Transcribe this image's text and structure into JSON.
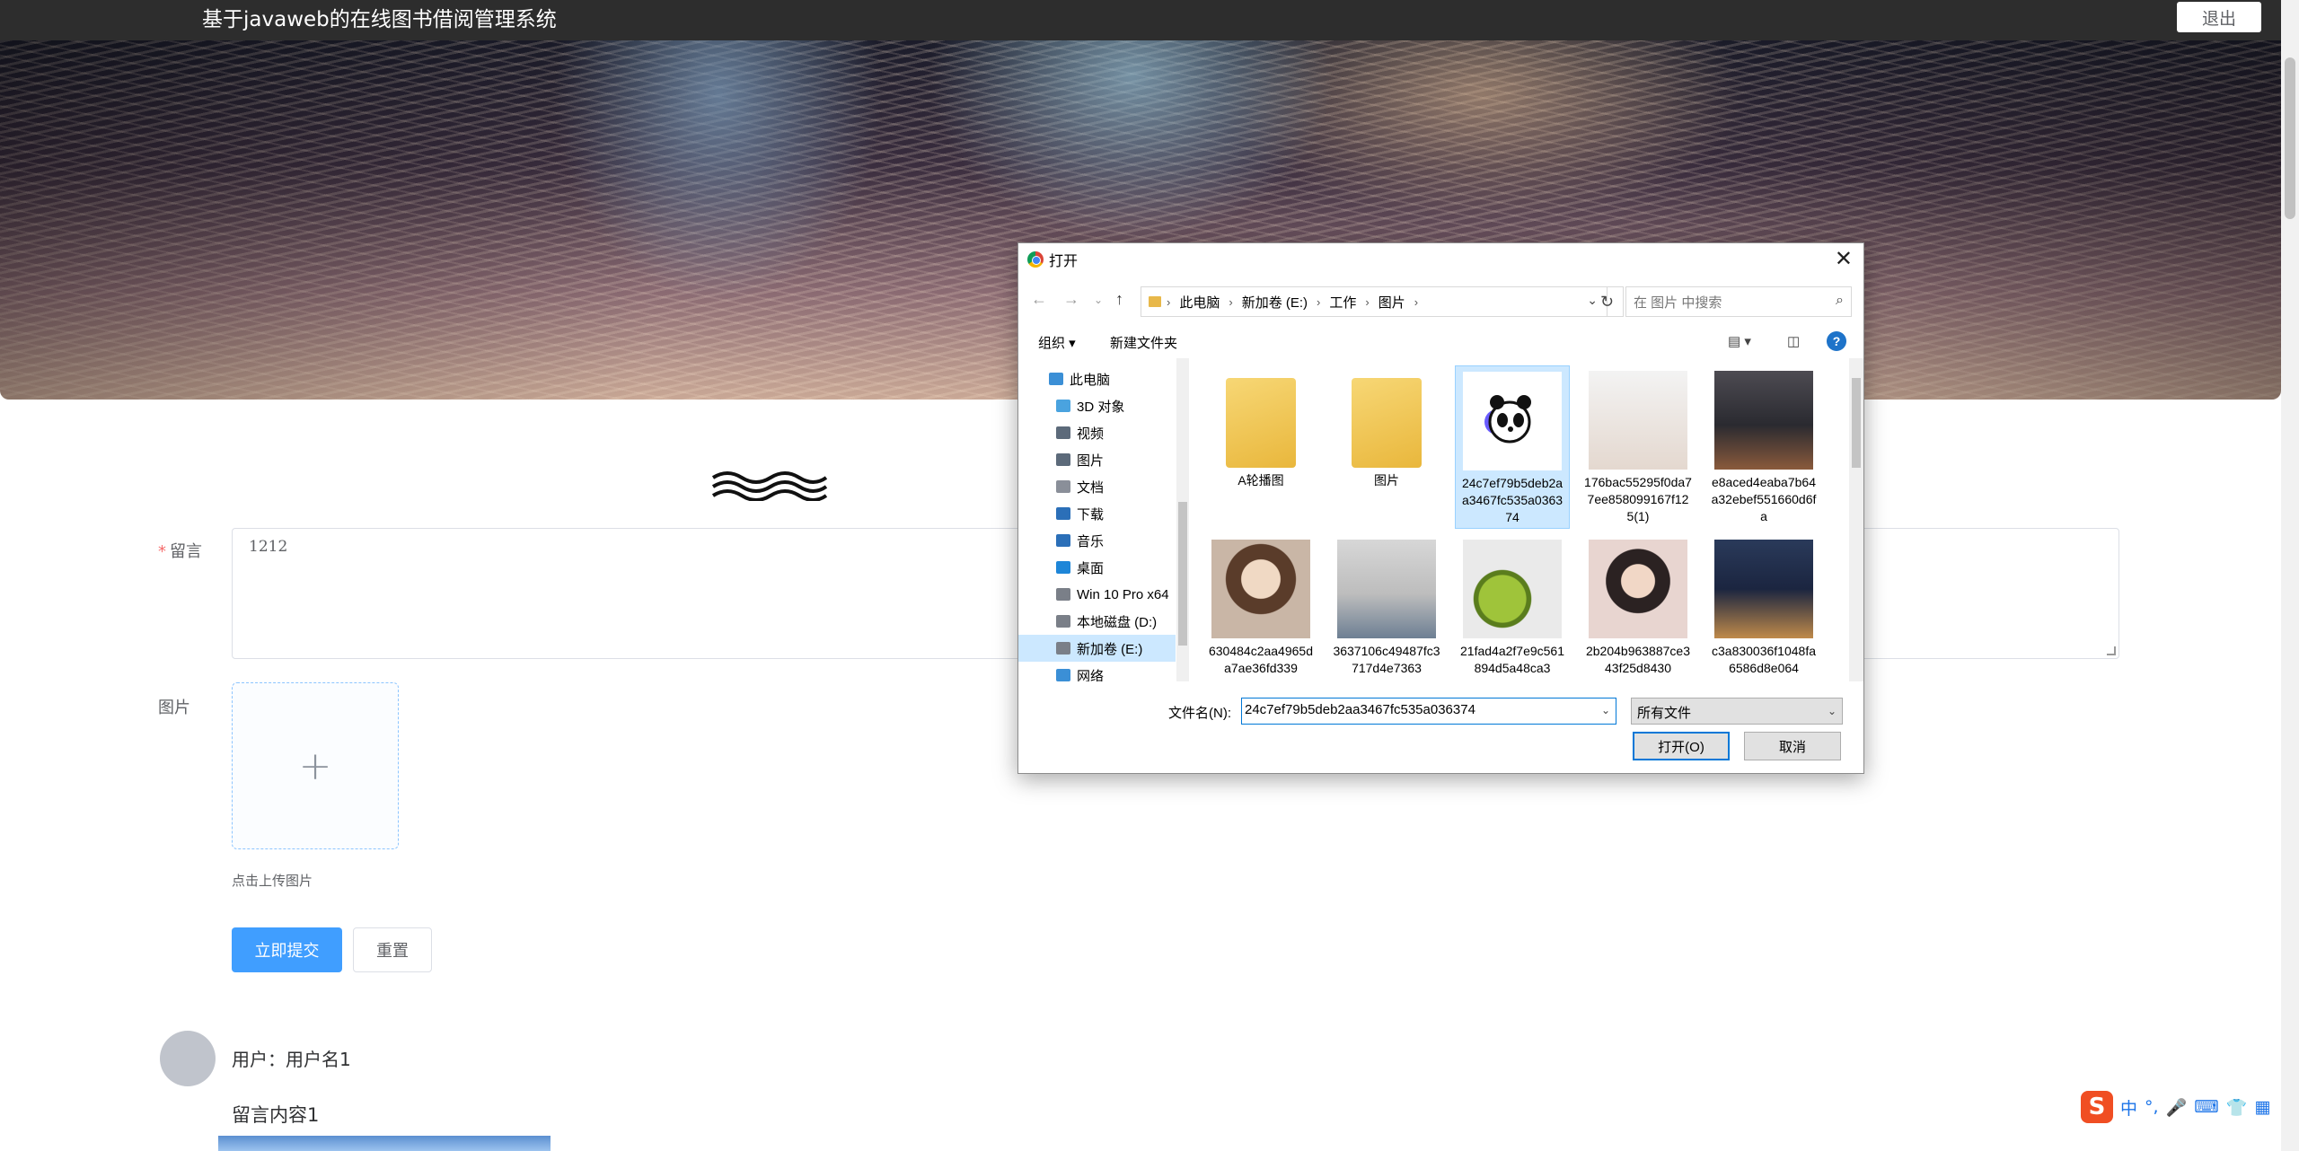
{
  "header": {
    "title": "基于javaweb的在线图书借阅管理系统",
    "logout_label": "退出"
  },
  "form": {
    "message_label": "留言",
    "message_value": "1212",
    "image_label": "图片",
    "upload_tip": "点击上传图片",
    "submit_label": "立即提交",
    "reset_label": "重置"
  },
  "comment": {
    "user": "用户：用户名1",
    "content": "留言内容1"
  },
  "dialog": {
    "title": "打开",
    "breadcrumb": [
      "此电脑",
      "新加卷 (E:)",
      "工作",
      "图片"
    ],
    "search_placeholder": "在 图片 中搜索",
    "organize_label": "组织 ▾",
    "new_folder_label": "新建文件夹",
    "tree": [
      {
        "label": "此电脑",
        "icon": "computer-icon"
      },
      {
        "label": "3D 对象",
        "icon": "3d-objects-icon"
      },
      {
        "label": "视频",
        "icon": "video-icon"
      },
      {
        "label": "图片",
        "icon": "pictures-icon"
      },
      {
        "label": "文档",
        "icon": "documents-icon"
      },
      {
        "label": "下载",
        "icon": "download-icon"
      },
      {
        "label": "音乐",
        "icon": "music-icon"
      },
      {
        "label": "桌面",
        "icon": "desktop-icon"
      },
      {
        "label": "Win 10 Pro x64",
        "icon": "drive-icon"
      },
      {
        "label": "本地磁盘 (D:)",
        "icon": "drive-icon"
      },
      {
        "label": "新加卷 (E:)",
        "icon": "drive-icon"
      },
      {
        "label": "网络",
        "icon": "network-icon"
      }
    ],
    "files": [
      {
        "name": "A轮播图",
        "kind": "folder"
      },
      {
        "name": "图片",
        "kind": "folder"
      },
      {
        "name": "24c7ef79b5deb2aa3467fc535a036374",
        "kind": "panda"
      },
      {
        "name": "176bac55295f0da77ee858099167f125(1)",
        "kind": "anime"
      },
      {
        "name": "e8aced4eaba7b64a32ebef551660d6fa",
        "kind": "car"
      },
      {
        "name": "630484c2aa4965da7ae36fd339",
        "kind": "girl1"
      },
      {
        "name": "3637106c49487fc3717d4e7363",
        "kind": "room"
      },
      {
        "name": "21fad4a2f7e9c561894d5a48ca3",
        "kind": "kiwi"
      },
      {
        "name": "2b204b963887ce343f25d8430",
        "kind": "girl2"
      },
      {
        "name": "c3a830036f1048fa6586d8e064",
        "kind": "boat"
      }
    ],
    "filename_label": "文件名(N):",
    "filename_value": "24c7ef79b5deb2aa3467fc535a036374",
    "filetype_value": "所有文件",
    "open_label": "打开(O)",
    "cancel_label": "取消"
  },
  "ime": {
    "items": [
      "中",
      "°,",
      "🎤",
      "⌨",
      "👕",
      "▦"
    ]
  }
}
